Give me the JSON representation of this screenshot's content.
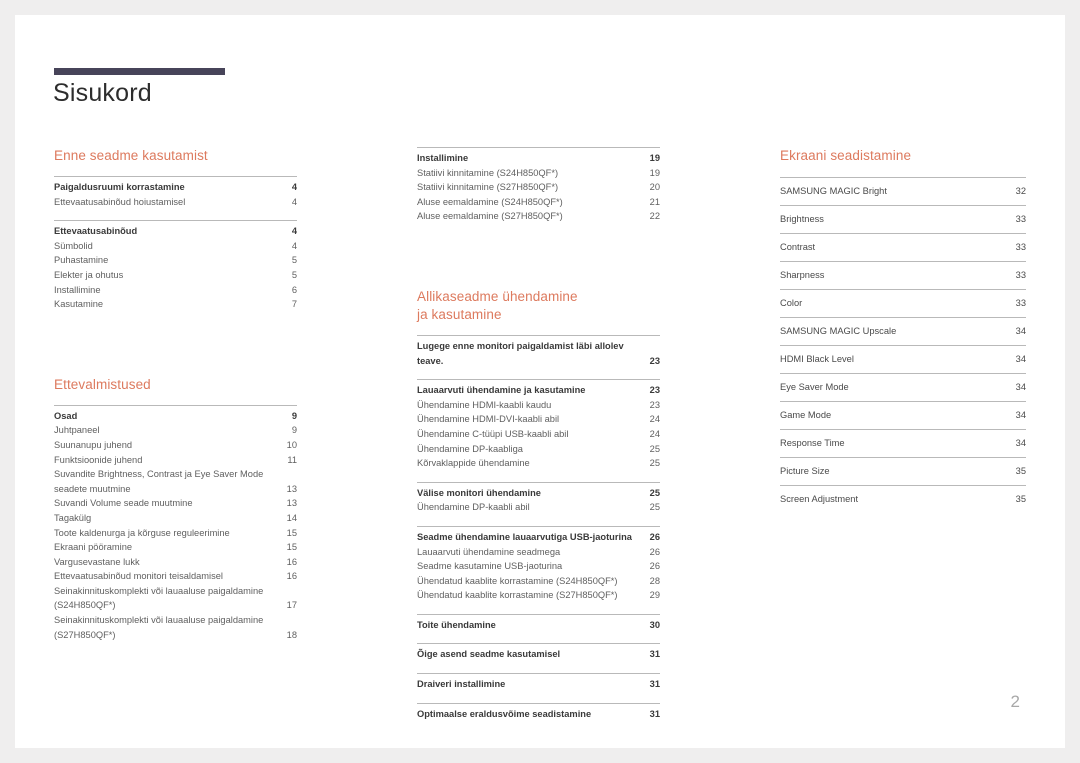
{
  "document": {
    "title": "Sisukord",
    "page_number": "2",
    "accent_color": "#dd7a5e",
    "rule_color": "#474459"
  },
  "columns": {
    "col1": {
      "sections": [
        {
          "heading": "Enne seadme kasutamist",
          "groups": [
            {
              "rows": [
                {
                  "label": "Paigaldusruumi korrastamine",
                  "page": "4",
                  "bold": true
                },
                {
                  "label": "Ettevaatusabinõud hoiustamisel",
                  "page": "4",
                  "bold": false
                }
              ]
            },
            {
              "rows": [
                {
                  "label": "Ettevaatusabinõud",
                  "page": "4",
                  "bold": true
                },
                {
                  "label": "Sümbolid",
                  "page": "4",
                  "bold": false
                },
                {
                  "label": "Puhastamine",
                  "page": "5",
                  "bold": false
                },
                {
                  "label": "Elekter ja ohutus",
                  "page": "5",
                  "bold": false
                },
                {
                  "label": "Installimine",
                  "page": "6",
                  "bold": false
                },
                {
                  "label": "Kasutamine",
                  "page": "7",
                  "bold": false
                }
              ]
            }
          ]
        },
        {
          "heading": "Ettevalmistused",
          "groups": [
            {
              "rows": [
                {
                  "label": "Osad",
                  "page": "9",
                  "bold": true
                },
                {
                  "label": "Juhtpaneel",
                  "page": "9",
                  "bold": false
                },
                {
                  "label": "Suunanupu juhend",
                  "page": "10",
                  "bold": false
                },
                {
                  "label": "Funktsioonide juhend",
                  "page": "11",
                  "bold": false
                },
                {
                  "label": "Suvandite Brightness, Contrast ja Eye Saver Mode\nseadete muutmine",
                  "page": "13",
                  "bold": false
                },
                {
                  "label": "Suvandi Volume seade muutmine",
                  "page": "13",
                  "bold": false
                },
                {
                  "label": "Tagakülg",
                  "page": "14",
                  "bold": false
                },
                {
                  "label": "Toote kaldenurga ja kõrguse reguleerimine",
                  "page": "15",
                  "bold": false
                },
                {
                  "label": "Ekraani pööramine",
                  "page": "15",
                  "bold": false
                },
                {
                  "label": "Vargusevastane lukk",
                  "page": "16",
                  "bold": false
                },
                {
                  "label": "Ettevaatusabinõud monitori teisaldamisel",
                  "page": "16",
                  "bold": false
                },
                {
                  "label": "Seinakinnituskomplekti või lauaaluse paigaldamine\n(S24H850QF*)",
                  "page": "17",
                  "bold": false
                },
                {
                  "label": "Seinakinnituskomplekti või lauaaluse paigaldamine\n(S27H850QF*)",
                  "page": "18",
                  "bold": false
                }
              ]
            }
          ]
        }
      ]
    },
    "col2": {
      "sections": [
        {
          "heading": "",
          "groups": [
            {
              "rows": [
                {
                  "label": "Installimine",
                  "page": "19",
                  "bold": true
                },
                {
                  "label": "Statiivi kinnitamine (S24H850QF*)",
                  "page": "19",
                  "bold": false
                },
                {
                  "label": "Statiivi kinnitamine (S27H850QF*)",
                  "page": "20",
                  "bold": false
                },
                {
                  "label": "Aluse eemaldamine (S24H850QF*)",
                  "page": "21",
                  "bold": false
                },
                {
                  "label": "Aluse eemaldamine (S27H850QF*)",
                  "page": "22",
                  "bold": false
                }
              ]
            }
          ]
        },
        {
          "heading": "Allikaseadme ühendamine\nja kasutamine",
          "groups": [
            {
              "rows": [
                {
                  "label": "Lugege enne monitori paigaldamist läbi allolev\nteave.",
                  "page": "23",
                  "bold": true
                }
              ]
            },
            {
              "rows": [
                {
                  "label": "Lauaarvuti ühendamine ja kasutamine",
                  "page": "23",
                  "bold": true
                },
                {
                  "label": "Ühendamine HDMI-kaabli kaudu",
                  "page": "23",
                  "bold": false
                },
                {
                  "label": "Ühendamine HDMI-DVI-kaabli abil",
                  "page": "24",
                  "bold": false
                },
                {
                  "label": "Ühendamine C-tüüpi USB-kaabli abil",
                  "page": "24",
                  "bold": false
                },
                {
                  "label": "Ühendamine DP-kaabliga",
                  "page": "25",
                  "bold": false
                },
                {
                  "label": "Kõrvaklappide ühendamine",
                  "page": "25",
                  "bold": false
                }
              ]
            },
            {
              "rows": [
                {
                  "label": "Välise monitori ühendamine",
                  "page": "25",
                  "bold": true
                },
                {
                  "label": "Ühendamine DP-kaabli abil",
                  "page": "25",
                  "bold": false
                }
              ]
            },
            {
              "rows": [
                {
                  "label": "Seadme ühendamine lauaarvutiga USB-jaoturina",
                  "page": "26",
                  "bold": true
                },
                {
                  "label": "Lauaarvuti ühendamine seadmega",
                  "page": "26",
                  "bold": false
                },
                {
                  "label": "Seadme kasutamine USB-jaoturina",
                  "page": "26",
                  "bold": false
                },
                {
                  "label": "Ühendatud kaablite korrastamine (S24H850QF*)",
                  "page": "28",
                  "bold": false
                },
                {
                  "label": "Ühendatud kaablite korrastamine (S27H850QF*)",
                  "page": "29",
                  "bold": false
                }
              ]
            },
            {
              "rows": [
                {
                  "label": "Toite ühendamine",
                  "page": "30",
                  "bold": true
                }
              ]
            },
            {
              "rows": [
                {
                  "label": "Õige asend seadme kasutamisel",
                  "page": "31",
                  "bold": true
                }
              ]
            },
            {
              "rows": [
                {
                  "label": "Draiveri installimine",
                  "page": "31",
                  "bold": true
                }
              ]
            },
            {
              "rows": [
                {
                  "label": "Optimaalse eraldusvõime seadistamine",
                  "page": "31",
                  "bold": true
                }
              ]
            }
          ]
        }
      ]
    },
    "col3": {
      "heading": "Ekraani seadistamine",
      "rows": [
        {
          "label": "SAMSUNG MAGIC Bright",
          "page": "32"
        },
        {
          "label": "Brightness",
          "page": "33"
        },
        {
          "label": "Contrast",
          "page": "33"
        },
        {
          "label": "Sharpness",
          "page": "33"
        },
        {
          "label": "Color",
          "page": "33"
        },
        {
          "label": "SAMSUNG MAGIC Upscale",
          "page": "34"
        },
        {
          "label": "HDMI Black Level",
          "page": "34"
        },
        {
          "label": "Eye Saver Mode",
          "page": "34"
        },
        {
          "label": "Game Mode",
          "page": "34"
        },
        {
          "label": "Response Time",
          "page": "34"
        },
        {
          "label": "Picture Size",
          "page": "35"
        },
        {
          "label": "Screen Adjustment",
          "page": "35"
        }
      ]
    }
  }
}
